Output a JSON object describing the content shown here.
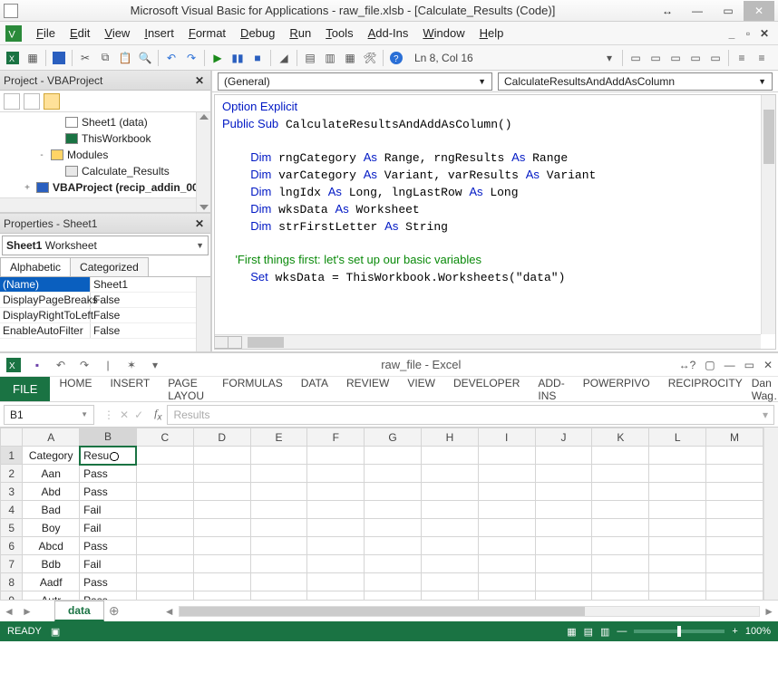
{
  "vba": {
    "title": "Microsoft Visual Basic for Applications - raw_file.xlsb - [Calculate_Results (Code)]",
    "menus": [
      "File",
      "Edit",
      "View",
      "Insert",
      "Format",
      "Debug",
      "Run",
      "Tools",
      "Add-Ins",
      "Window",
      "Help"
    ],
    "position": "Ln 8, Col 16",
    "project": {
      "title": "Project - VBAProject",
      "items": [
        {
          "indent": 3,
          "icon": "sheet",
          "label": "Sheet1 (data)"
        },
        {
          "indent": 3,
          "icon": "book",
          "label": "ThisWorkbook"
        },
        {
          "indent": 2,
          "exp": "-",
          "icon": "folder",
          "label": "Modules"
        },
        {
          "indent": 3,
          "icon": "module",
          "label": "Calculate_Results"
        },
        {
          "indent": 1,
          "exp": "+",
          "icon": "proj",
          "label": "VBAProject (recip_addin_00",
          "bold": true
        }
      ]
    },
    "properties": {
      "title": "Properties - Sheet1",
      "object": "Sheet1",
      "object_type": "Worksheet",
      "tabs": [
        "Alphabetic",
        "Categorized"
      ],
      "active_tab": 0,
      "rows": [
        {
          "k": "(Name)",
          "v": "Sheet1",
          "sel": true
        },
        {
          "k": "DisplayPageBreaks",
          "v": "False"
        },
        {
          "k": "DisplayRightToLeft",
          "v": "False"
        },
        {
          "k": "EnableAutoFilter",
          "v": "False"
        }
      ]
    },
    "code": {
      "left_combo": "(General)",
      "right_combo": "CalculateResultsAndAddAsColumn",
      "lines": [
        {
          "t": "kw",
          "s": "Option Explicit"
        },
        {
          "t": "mix",
          "s": [
            "Public Sub",
            " CalculateResultsAndAddAsColumn()"
          ]
        },
        {
          "t": "blank"
        },
        {
          "t": "dim",
          "s": [
            "    ",
            "Dim",
            " rngCategory ",
            "As",
            " Range, rngResults ",
            "As",
            " Range"
          ]
        },
        {
          "t": "dim",
          "s": [
            "    ",
            "Dim",
            " varCategory ",
            "As",
            " Variant, varResults ",
            "As",
            " Variant"
          ]
        },
        {
          "t": "dim",
          "s": [
            "    ",
            "Dim",
            " lngIdx ",
            "As",
            " Long, lngLastRow ",
            "As",
            " Long"
          ]
        },
        {
          "t": "dim",
          "s": [
            "    ",
            "Dim",
            " wksData ",
            "As",
            " Worksheet"
          ]
        },
        {
          "t": "dim",
          "s": [
            "    ",
            "Dim",
            " strFirstLetter ",
            "As",
            " String"
          ]
        },
        {
          "t": "blank"
        },
        {
          "t": "cm",
          "s": "    'First things first: let's set up our basic variables"
        },
        {
          "t": "set",
          "s": [
            "    ",
            "Set",
            " wksData = ThisWorkbook.Worksheets(\"data\")"
          ]
        }
      ]
    }
  },
  "excel": {
    "qat_title": "raw_file - Excel",
    "ribbon": {
      "file": "FILE",
      "tabs": [
        "HOME",
        "INSERT",
        "PAGE LAYOU",
        "FORMULAS",
        "DATA",
        "REVIEW",
        "VIEW",
        "DEVELOPER",
        "ADD-INS",
        "POWERPIVO",
        "RECIPROCITY"
      ],
      "user": "Dan Wag…"
    },
    "namebox": "B1",
    "formula": "Results",
    "columns": [
      "A",
      "B",
      "C",
      "D",
      "E",
      "F",
      "G",
      "H",
      "I",
      "J",
      "K",
      "L",
      "M"
    ],
    "rows": [
      {
        "n": "1",
        "cells": [
          "Category",
          "Resu"
        ]
      },
      {
        "n": "2",
        "cells": [
          "Aan",
          "Pass"
        ]
      },
      {
        "n": "3",
        "cells": [
          "Abd",
          "Pass"
        ]
      },
      {
        "n": "4",
        "cells": [
          "Bad",
          "Fail"
        ]
      },
      {
        "n": "5",
        "cells": [
          "Boy",
          "Fail"
        ]
      },
      {
        "n": "6",
        "cells": [
          "Abcd",
          "Pass"
        ]
      },
      {
        "n": "7",
        "cells": [
          "Bdb",
          "Fail"
        ]
      },
      {
        "n": "8",
        "cells": [
          "Aadf",
          "Pass"
        ]
      },
      {
        "n": "9",
        "cells": [
          "Autr",
          "Pass"
        ]
      }
    ],
    "selected": {
      "row": 0,
      "col": 1
    },
    "sheet_tab": "data",
    "status": "READY",
    "zoom": "100%"
  }
}
